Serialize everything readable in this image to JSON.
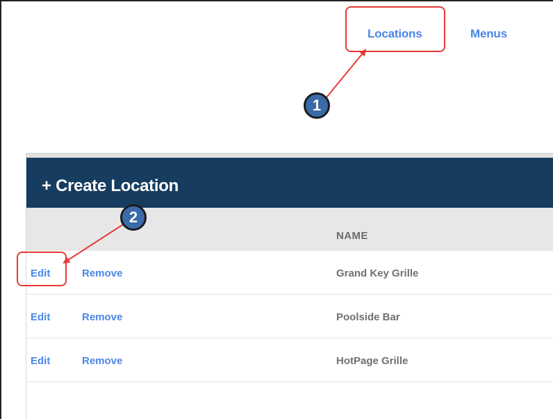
{
  "nav": {
    "locations_label": "Locations",
    "menus_label": "Menus"
  },
  "panel": {
    "create_label": "+ Create Location",
    "column_name_label": "NAME"
  },
  "rows": [
    {
      "edit_label": "Edit",
      "remove_label": "Remove",
      "name": "Grand Key Grille"
    },
    {
      "edit_label": "Edit",
      "remove_label": "Remove",
      "name": "Poolside Bar"
    },
    {
      "edit_label": "Edit",
      "remove_label": "Remove",
      "name": "HotPage Grille"
    }
  ],
  "annotations": {
    "step1": "1",
    "step2": "2",
    "highlight_color": "#e53935",
    "badge_color": "#3a6aa8"
  },
  "colors": {
    "link": "#4a86e8",
    "header_bg": "#163d5f",
    "column_header_bg": "#e7e7e7"
  }
}
